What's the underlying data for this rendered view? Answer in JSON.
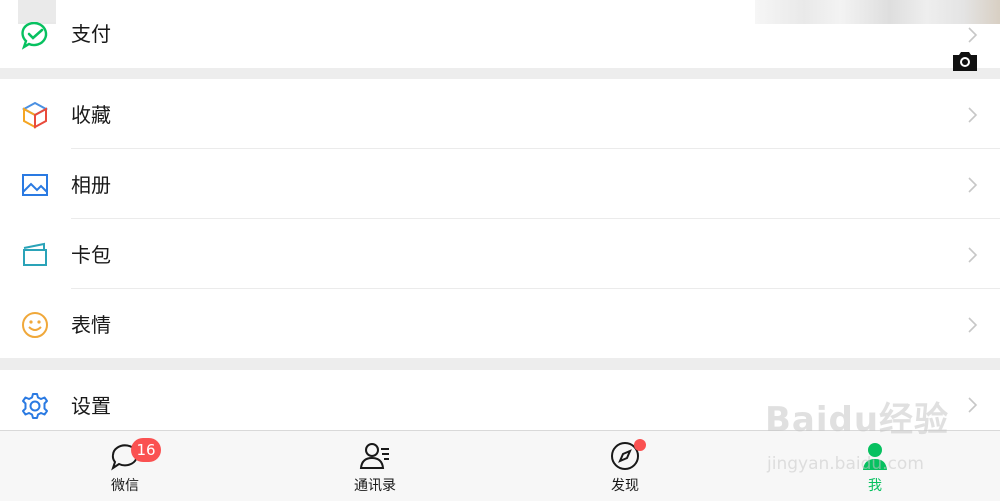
{
  "menu": {
    "items": [
      {
        "label": "支付",
        "icon": "wechat-pay-icon"
      },
      {
        "label": "收藏",
        "icon": "favorites-cube-icon"
      },
      {
        "label": "相册",
        "icon": "photo-album-icon"
      },
      {
        "label": "卡包",
        "icon": "card-wallet-icon"
      },
      {
        "label": "表情",
        "icon": "smiley-icon"
      },
      {
        "label": "设置",
        "icon": "gear-icon"
      }
    ]
  },
  "tabbar": {
    "tabs": [
      {
        "label": "微信",
        "icon": "chat-bubble-icon",
        "badge": "16"
      },
      {
        "label": "通讯录",
        "icon": "contacts-icon"
      },
      {
        "label": "发现",
        "icon": "compass-icon",
        "dot": true
      },
      {
        "label": "我",
        "icon": "person-icon",
        "active": true
      }
    ]
  },
  "watermark": {
    "brand": "Baidu经验",
    "url": "jingyan.baidu.com"
  },
  "colors": {
    "accent": "#07c160",
    "badge": "#fa5151",
    "background": "#ededed"
  }
}
